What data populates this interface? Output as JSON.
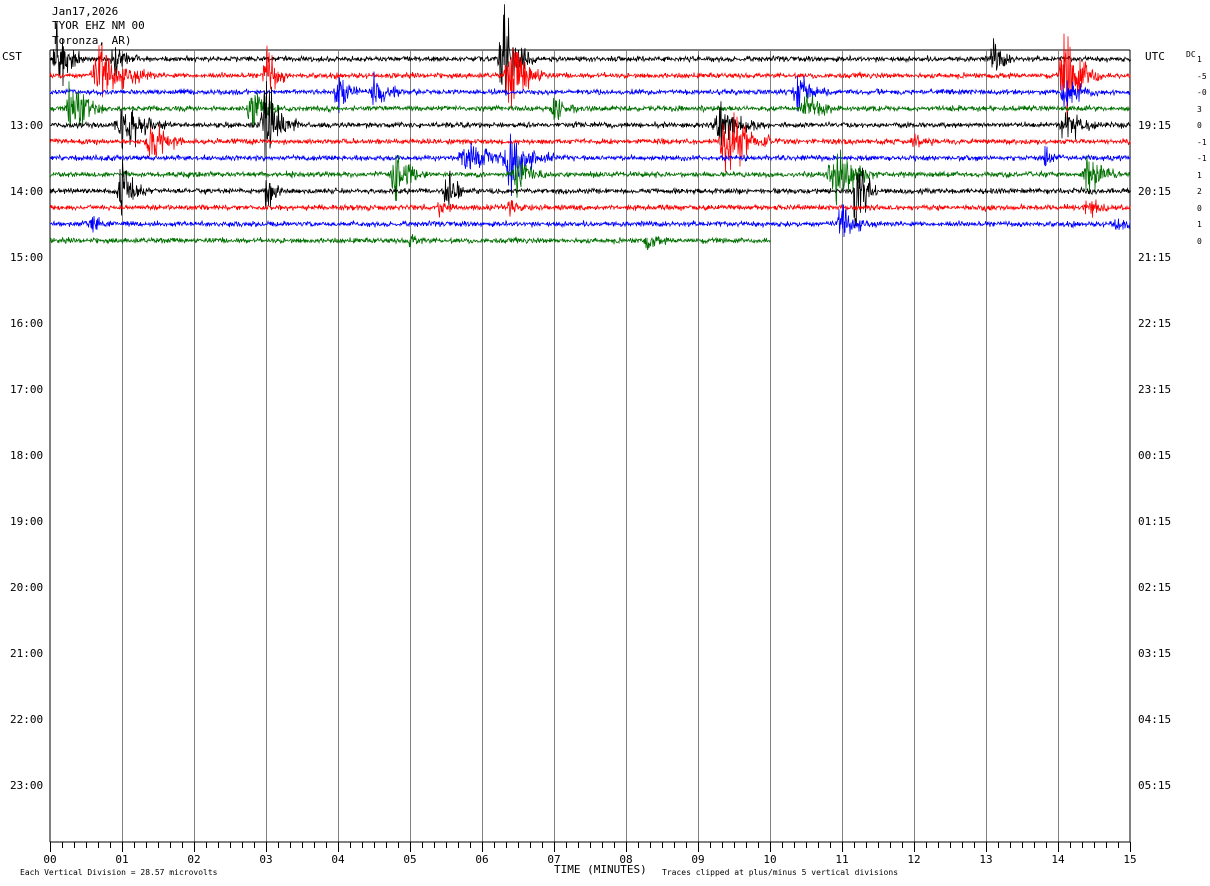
{
  "header": {
    "date": "Jan17,2026",
    "station": "TYOR EHZ NM 00",
    "location": "Toronza, AR)"
  },
  "left_zone": "CST",
  "right_zone": "UTC",
  "dc_label": "DC",
  "dc_values": [
    "1",
    "-5",
    "-0",
    "3",
    "0",
    "-1",
    "-1",
    "1",
    "2",
    "0",
    "1",
    "0"
  ],
  "left_times": [
    "13:00",
    "14:00",
    "15:00",
    "16:00",
    "17:00",
    "18:00",
    "19:00",
    "20:00",
    "21:00",
    "22:00",
    "23:00"
  ],
  "right_times": [
    "19:15",
    "20:15",
    "21:15",
    "22:15",
    "23:15",
    "00:15",
    "01:15",
    "02:15",
    "03:15",
    "04:15",
    "05:15"
  ],
  "chart_data": {
    "type": "line",
    "title": "Jan17,2026 TYOR EHZ NM 00",
    "xlabel": "TIME (MINUTES)",
    "x_ticks": [
      "00",
      "01",
      "02",
      "03",
      "04",
      "05",
      "06",
      "07",
      "08",
      "09",
      "10",
      "11",
      "12",
      "13",
      "14",
      "15"
    ],
    "xlim": [
      0,
      15
    ],
    "trace_colors": [
      "#000000",
      "#ff0000",
      "#0000ff",
      "#007000"
    ],
    "trace_count": 12,
    "last_trace_end_minute": 10.0,
    "grid": true
  },
  "footer": {
    "scale": "Each Vertical Division =   28.57 microvolts",
    "clip": "Traces clipped at plus/minus 5 vertical divisions"
  }
}
